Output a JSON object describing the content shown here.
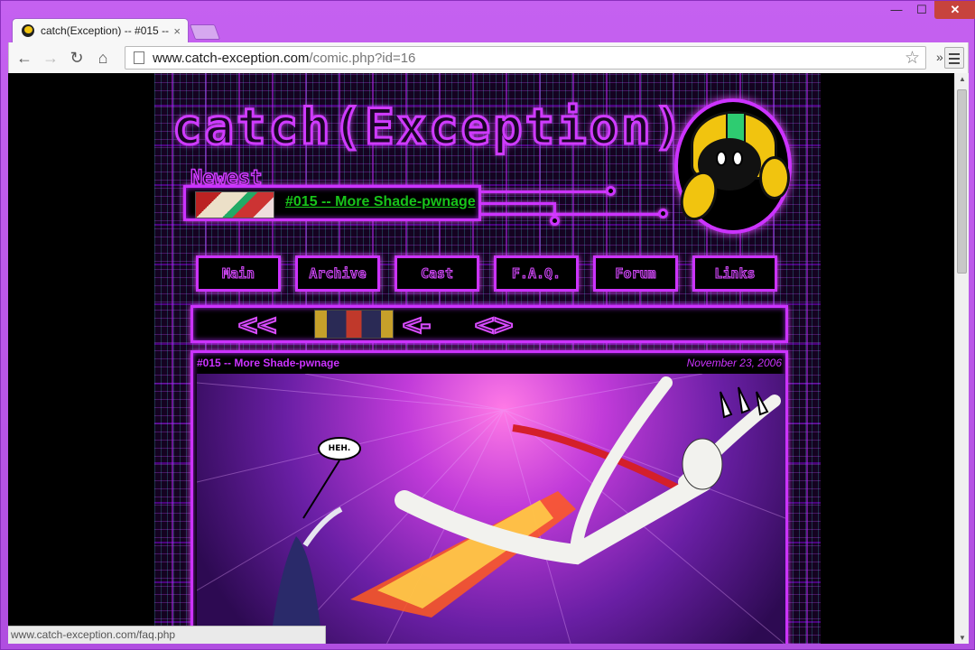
{
  "browser": {
    "tab_title": "catch(Exception) -- #015 --",
    "tab_close": "×",
    "window_controls": {
      "minimize": "—",
      "maximize": "☐",
      "close": "✕"
    },
    "back": "←",
    "forward": "→",
    "reload": "↻",
    "home": "⌂",
    "url_host": "www.catch-exception.com",
    "url_path": "/comic.php?id=16",
    "star": "☆",
    "overflow": "»",
    "status_text": "www.catch-exception.com/faq.php"
  },
  "site": {
    "logo": "catch(Exception)",
    "newest_label": "Newest",
    "newest_link": "#015 -- More Shade-pwnage",
    "nav": [
      "Main",
      "Archive",
      "Cast",
      "F.A.Q.",
      "Forum",
      "Links"
    ],
    "pager": {
      "first": "<<",
      "prev": "<-",
      "random": "<>"
    },
    "comic_title": "#015 -- More Shade-pwnage",
    "comic_date": "November 23, 2006",
    "speech": "HEH."
  },
  "colors": {
    "accent": "#cc33ff",
    "link": "#18c41a",
    "close_button": "#c7433d",
    "chrome_frame": "#b04ee0"
  }
}
